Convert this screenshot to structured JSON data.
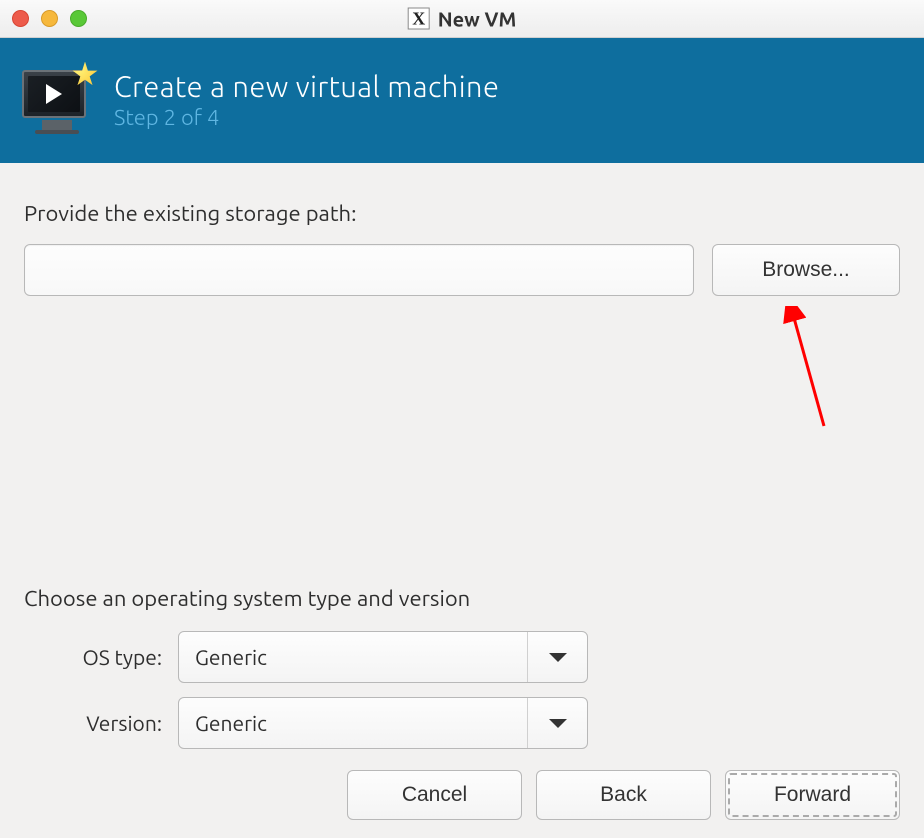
{
  "window": {
    "title": "New VM",
    "app_icon_label": "X"
  },
  "header": {
    "title": "Create a new virtual machine",
    "step": "Step 2 of 4"
  },
  "content": {
    "storage_label": "Provide the existing storage path:",
    "storage_value": "",
    "browse_label": "Browse...",
    "os_section_label": "Choose an operating system type and version",
    "os_type_label": "OS type:",
    "os_type_value": "Generic",
    "version_label": "Version:",
    "version_value": "Generic"
  },
  "footer": {
    "cancel": "Cancel",
    "back": "Back",
    "forward": "Forward"
  }
}
